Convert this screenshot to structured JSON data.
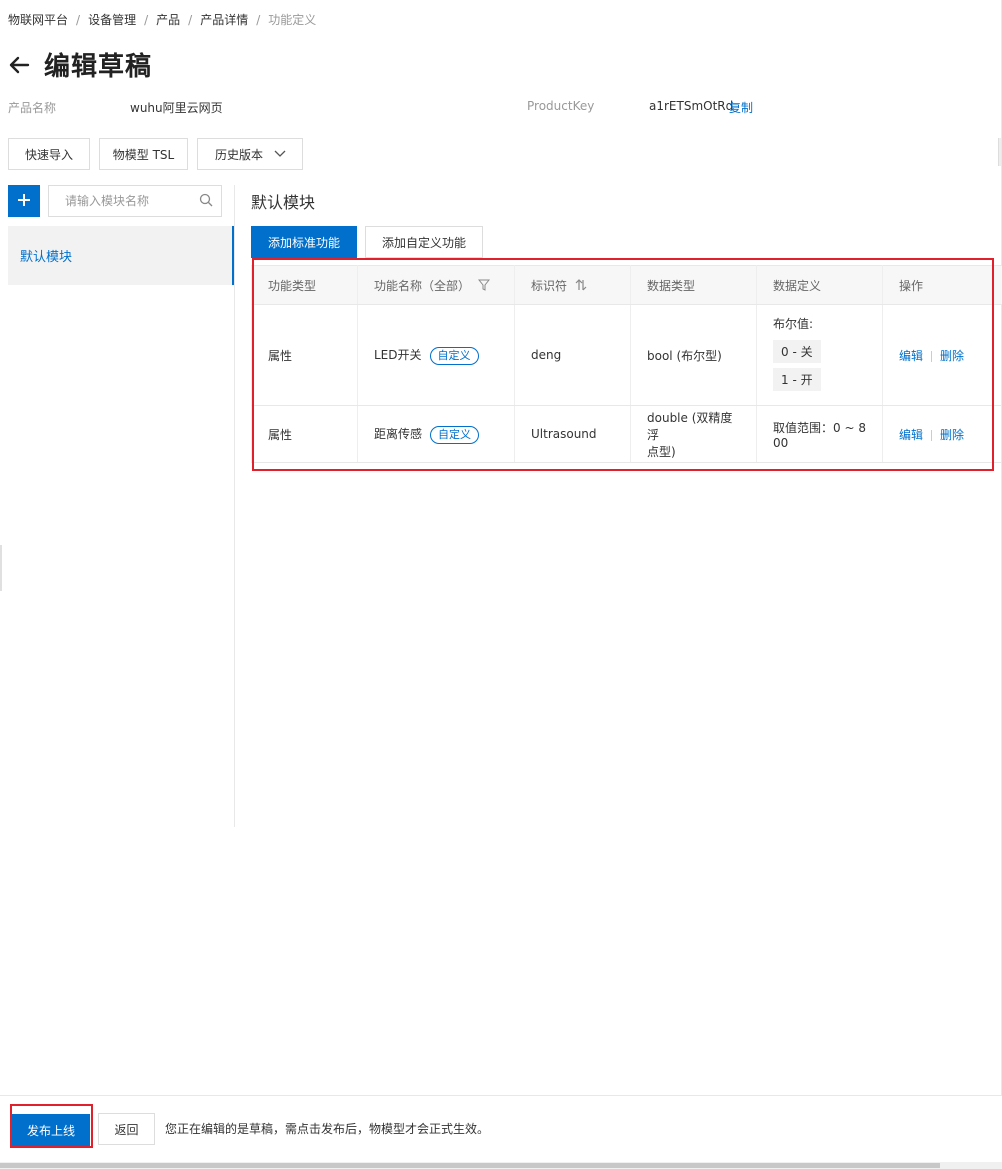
{
  "breadcrumb": [
    "物联网平台",
    "设备管理",
    "产品",
    "产品详情",
    "功能定义"
  ],
  "breadcrumb_separator": "/",
  "page_title": "编辑草稿",
  "product": {
    "name_label": "产品名称",
    "name_value": "wuhu阿里云网页",
    "key_label": "ProductKey",
    "key_value": "a1rETSmOtRd",
    "copy_label": "复制"
  },
  "toolbar": {
    "quick_import": "快速导入",
    "tsl": "物模型 TSL",
    "history": "历史版本"
  },
  "sidebar": {
    "search_placeholder": "请输入模块名称",
    "modules": [
      "默认模块"
    ]
  },
  "main": {
    "module_title": "默认模块",
    "tabs": [
      "添加标准功能",
      "添加自定义功能"
    ]
  },
  "table": {
    "headers": [
      "功能类型",
      "功能名称（全部）",
      "标识符",
      "数据类型",
      "数据定义",
      "操作"
    ],
    "rows": [
      {
        "type": "属性",
        "name": "LED开关",
        "tag": "自定义",
        "identifier": "deng",
        "data_type": "bool (布尔型)",
        "def_label": "布尔值:",
        "def_values": [
          "0 - 关",
          "1 - 开"
        ],
        "edit": "编辑",
        "delete": "删除"
      },
      {
        "type": "属性",
        "name": "距离传感",
        "tag": "自定义",
        "identifier": "Ultrasound",
        "data_type_line1": "double (双精度浮",
        "data_type_line2": "点型)",
        "range_line1": "取值范围：0 ~ 8",
        "range_line2": "00",
        "edit": "编辑",
        "delete": "删除"
      }
    ]
  },
  "footer": {
    "publish": "发布上线",
    "return": "返回",
    "note": "您正在编辑的是草稿，需点击发布后，物模型才会正式生效。"
  },
  "colors": {
    "primary": "#0070cc",
    "highlight_box": "#e0202a"
  }
}
